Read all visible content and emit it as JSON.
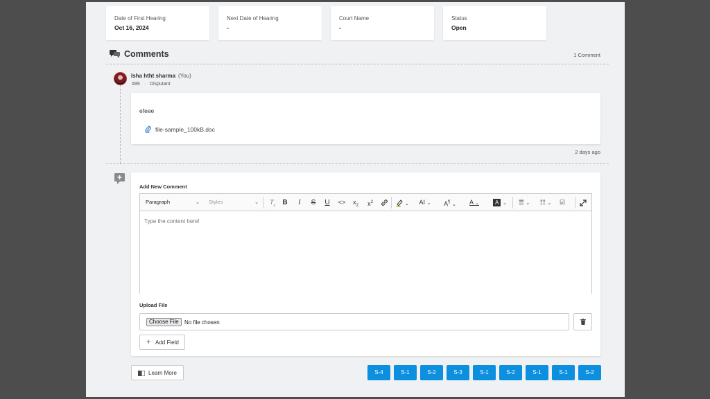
{
  "info_cards": [
    {
      "label": "Date of First Hearing",
      "value": "Oct 16, 2024"
    },
    {
      "label": "Next Date of Hearing",
      "value": "-"
    },
    {
      "label": "Court Name",
      "value": "-"
    },
    {
      "label": "Status",
      "value": "Open"
    }
  ],
  "comments": {
    "title": "Comments",
    "count": "1 Comment",
    "items": [
      {
        "author": "Isha htht sharma",
        "you_tag": "(You)",
        "id": "#89",
        "role": "Disputant",
        "text": "efeee",
        "attachment": "file-sample_100kB.doc",
        "time_ago": "2 days ago"
      }
    ]
  },
  "new_comment": {
    "label": "Add New Comment",
    "paragraph_select": "Paragraph",
    "styles_select": "Styles",
    "placeholder": "Type the content here!",
    "upload_label": "Upload File",
    "choose_file": "Choose File",
    "no_file": "No file chosen",
    "add_field": "Add Field"
  },
  "footer": {
    "learn_more": "Learn More",
    "stage_buttons": [
      "S-4",
      "S-1",
      "S-2",
      "S-3",
      "S-1",
      "S-2",
      "S-1",
      "S-1",
      "S-2"
    ]
  },
  "colors": {
    "accent": "#0d8fe0",
    "attachment_icon": "#4a90d9"
  }
}
